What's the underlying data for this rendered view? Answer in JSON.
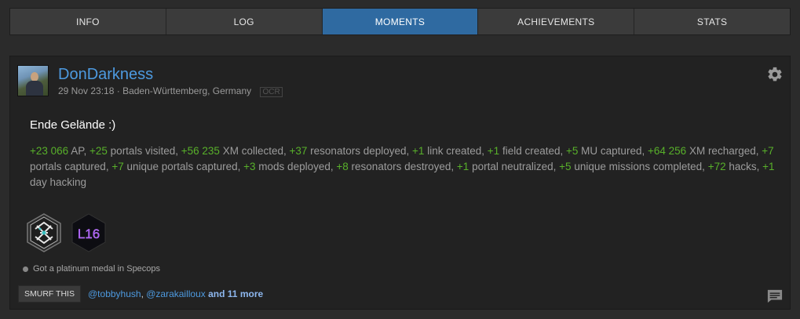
{
  "tabs": [
    {
      "label": "INFO"
    },
    {
      "label": "LOG"
    },
    {
      "label": "MOMENTS"
    },
    {
      "label": "ACHIEVEMENTS"
    },
    {
      "label": "STATS"
    }
  ],
  "active_tab": "MOMENTS",
  "post": {
    "username": "DonDarkness",
    "date": "29 Nov 23:18",
    "location": "Baden-Württemberg, Germany",
    "ocr_label": "OCR",
    "title": "Ende Gelände :)",
    "stats": [
      {
        "num": "+23 066",
        "label": "AP"
      },
      {
        "num": "+25",
        "label": "portals visited"
      },
      {
        "num": "+56 235",
        "label": "XM collected"
      },
      {
        "num": "+37",
        "label": "resonators deployed"
      },
      {
        "num": "+1",
        "label": "link created"
      },
      {
        "num": "+1",
        "label": "field created"
      },
      {
        "num": "+5",
        "label": "MU captured"
      },
      {
        "num": "+64 256",
        "label": "XM recharged"
      },
      {
        "num": "+7",
        "label": "portals captured"
      },
      {
        "num": "+7",
        "label": "unique portals captured"
      },
      {
        "num": "+3",
        "label": "mods deployed"
      },
      {
        "num": "+8",
        "label": "resonators destroyed"
      },
      {
        "num": "+1",
        "label": "portal neutralized"
      },
      {
        "num": "+5",
        "label": "unique missions completed"
      },
      {
        "num": "+72",
        "label": "hacks"
      },
      {
        "num": "+1",
        "label": "day hacking"
      }
    ],
    "badges": {
      "badge1_icon": "specops-medal-icon",
      "badge2_icon": "level-badge-icon",
      "badge2_text": "L16"
    },
    "medal_text": "Got a platinum medal in Specops",
    "smurf_button": "SMURF THIS",
    "smurfers": {
      "user1": "@tobbyhush",
      "sep": ", ",
      "user2": "@zarakailloux",
      "and": " and ",
      "more": "11 more"
    }
  },
  "colors": {
    "accent_blue": "#2f6aa1",
    "link_blue": "#4d9ae0",
    "stat_green": "#58b02a",
    "level_purple": "#a855f7"
  }
}
